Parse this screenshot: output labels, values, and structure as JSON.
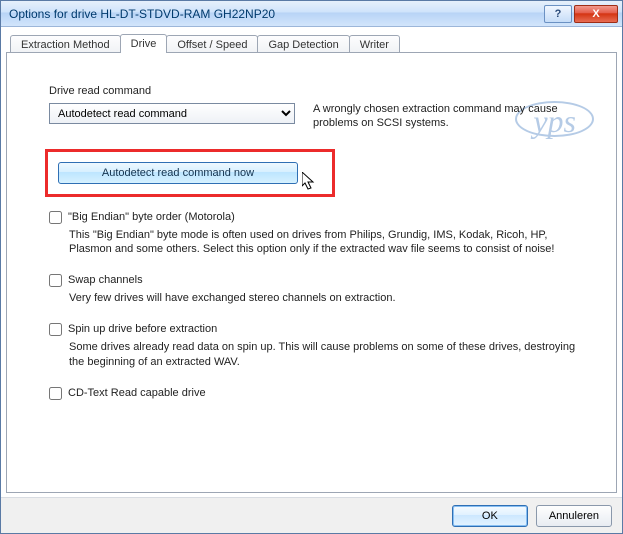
{
  "titlebar": {
    "title": "Options for drive HL-DT-STDVD-RAM GH22NP20",
    "help_glyph": "?",
    "close_glyph": "X"
  },
  "tabs": {
    "items": [
      {
        "label": "Extraction Method"
      },
      {
        "label": "Drive"
      },
      {
        "label": "Offset / Speed"
      },
      {
        "label": "Gap Detection"
      },
      {
        "label": "Writer"
      }
    ],
    "active_index": 1
  },
  "drive_panel": {
    "read_command_label": "Drive read command",
    "select_value": "Autodetect read command",
    "hint_text": "A wrongly chosen extraction command may cause problems on SCSI systems.",
    "autodetect_btn": "Autodetect read command now",
    "options": [
      {
        "label": "\"Big Endian\" byte order (Motorola)",
        "desc": "This \"Big Endian\" byte mode is often used on drives from Philips, Grundig, IMS, Kodak, Ricoh, HP, Plasmon and some others. Select this option only if the extracted wav file seems to consist of noise!"
      },
      {
        "label": "Swap channels",
        "desc": "Very few drives will have exchanged stereo channels on extraction."
      },
      {
        "label": "Spin up drive before extraction",
        "desc": "Some drives already read data on spin up. This will cause problems on some of these drives, destroying the beginning of an extracted WAV."
      },
      {
        "label": "CD-Text Read capable drive",
        "desc": ""
      }
    ]
  },
  "watermark": {
    "text": "yps"
  },
  "footer": {
    "ok": "OK",
    "cancel": "Annuleren"
  },
  "colors": {
    "highlight_red": "#ec2b2b",
    "accent_blue": "#2f6fb4"
  }
}
